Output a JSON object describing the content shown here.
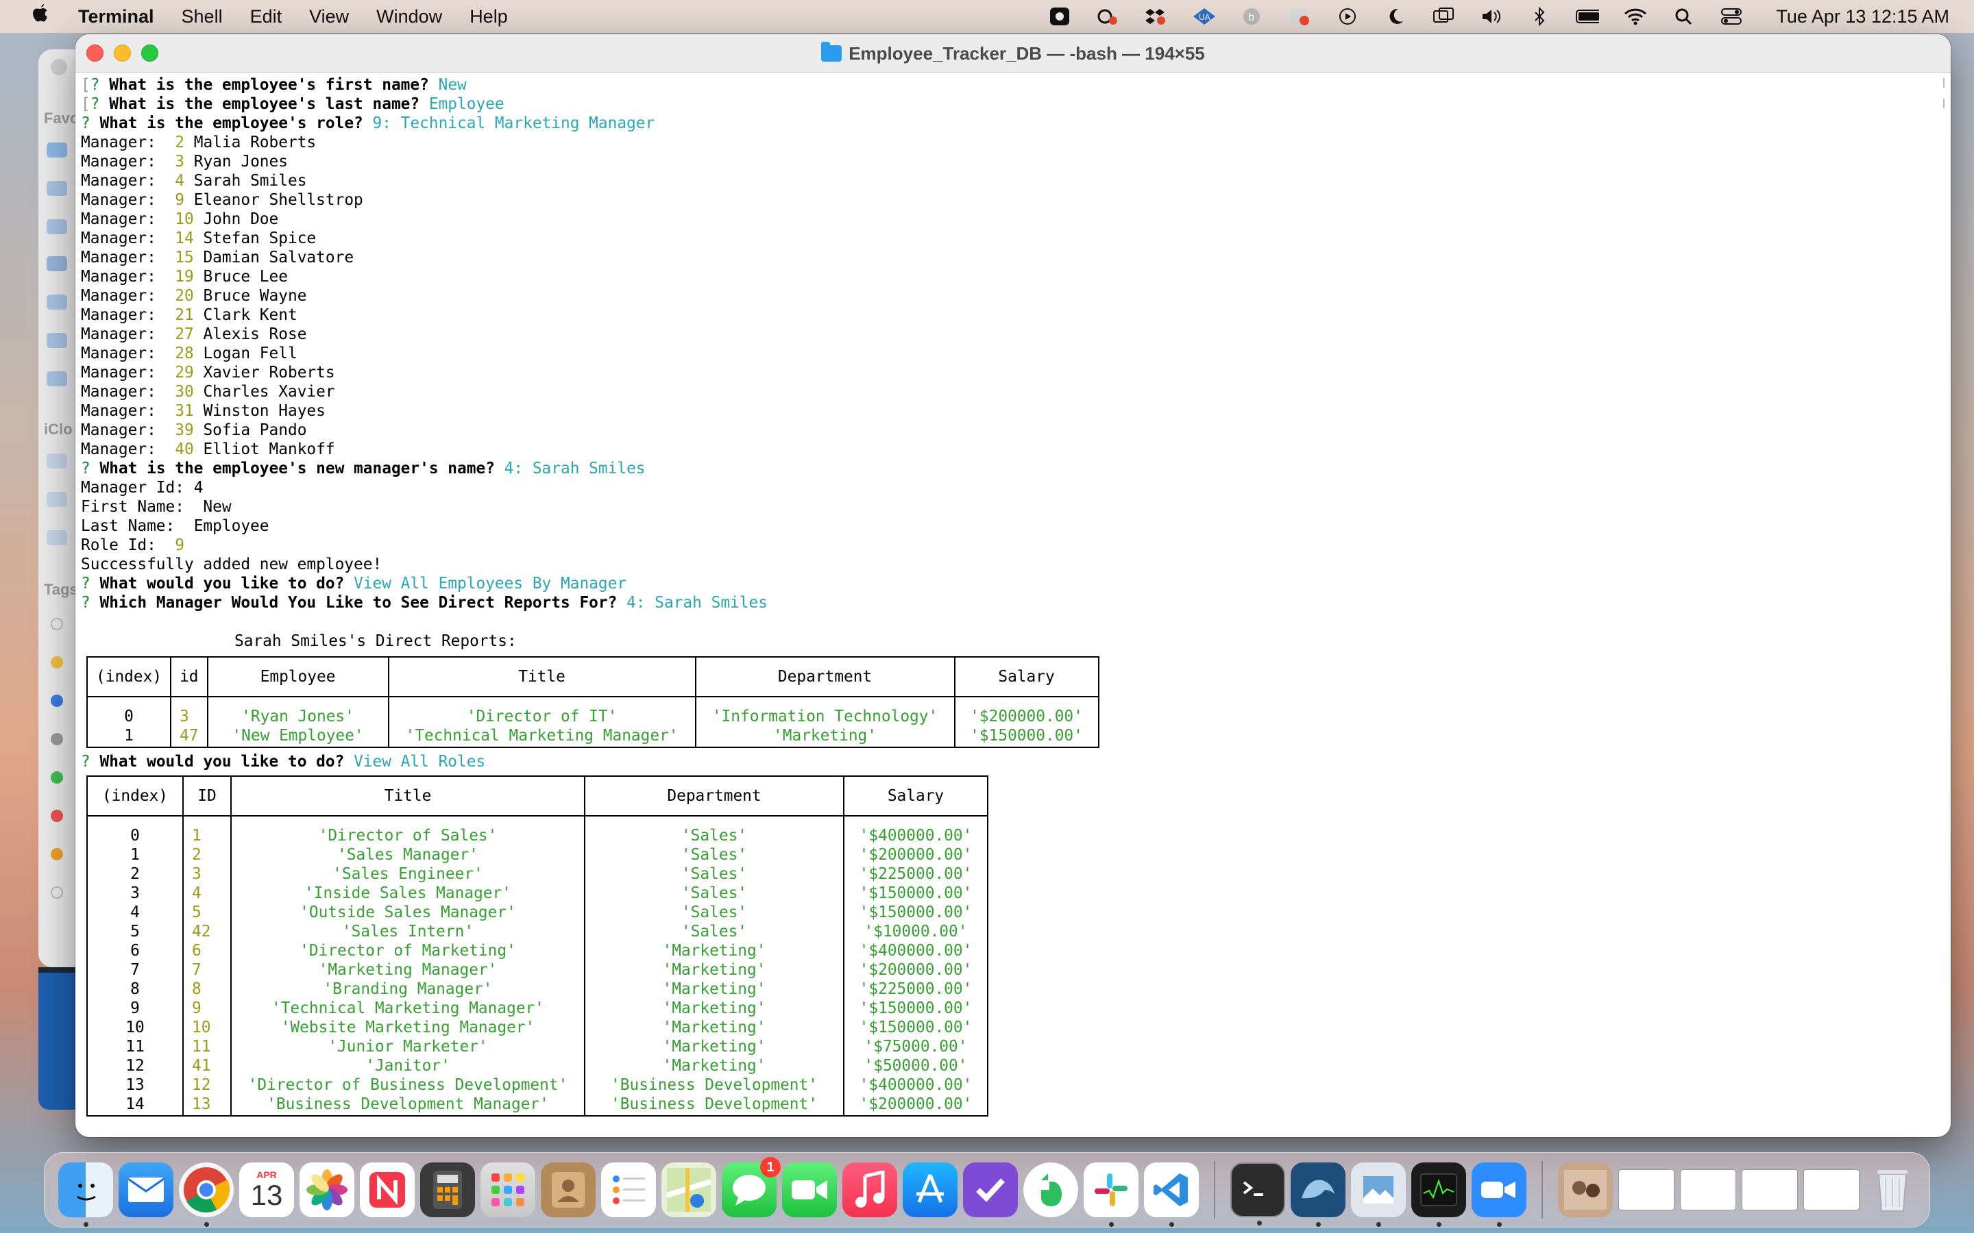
{
  "menubar": {
    "app_name": "Terminal",
    "menus": [
      "Shell",
      "Edit",
      "View",
      "Window",
      "Help"
    ],
    "clock": "Tue Apr 13  12:15 AM"
  },
  "window": {
    "title": "Employee_Tracker_DB — -bash — 194×55"
  },
  "terminal": {
    "prompt_first_name": {
      "q": "What is the employee's first name?",
      "a": "New"
    },
    "prompt_last_name": {
      "q": "What is the employee's last name?",
      "a": "Employee"
    },
    "prompt_role": {
      "q": "What is the employee's role?",
      "a": "9: Technical Marketing Manager"
    },
    "manager_label": "Manager:",
    "managers": [
      {
        "id": "2",
        "name": "Malia Roberts"
      },
      {
        "id": "3",
        "name": "Ryan Jones"
      },
      {
        "id": "4",
        "name": "Sarah Smiles"
      },
      {
        "id": "9",
        "name": "Eleanor Shellstrop"
      },
      {
        "id": "10",
        "name": "John Doe"
      },
      {
        "id": "14",
        "name": "Stefan Spice"
      },
      {
        "id": "15",
        "name": "Damian Salvatore"
      },
      {
        "id": "19",
        "name": "Bruce Lee"
      },
      {
        "id": "20",
        "name": "Bruce Wayne"
      },
      {
        "id": "21",
        "name": "Clark Kent"
      },
      {
        "id": "27",
        "name": "Alexis Rose"
      },
      {
        "id": "28",
        "name": "Logan Fell"
      },
      {
        "id": "29",
        "name": "Xavier Roberts"
      },
      {
        "id": "30",
        "name": "Charles Xavier"
      },
      {
        "id": "31",
        "name": "Winston Hayes"
      },
      {
        "id": "39",
        "name": "Sofia Pando"
      },
      {
        "id": "40",
        "name": "Elliot Mankoff"
      }
    ],
    "prompt_manager": {
      "q": "What is the employee's new manager's name?",
      "a": "4: Sarah Smiles"
    },
    "summary": {
      "manager_id": "Manager Id: 4",
      "first_name": "First Name:  New",
      "last_name": "Last Name:  Employee",
      "role_id_label": "Role Id:",
      "role_id": "9",
      "success": "Successfully added new employee!"
    },
    "prompt_todo_1": {
      "q": "What would you like to do?",
      "a": "View All Employees By Manager"
    },
    "prompt_which_manager": {
      "q": "Which Manager Would You Like to See Direct Reports For?",
      "a": "4: Sarah Smiles"
    },
    "direct_reports_heading": "Sarah Smiles's Direct Reports:",
    "direct_reports_table": {
      "headers": [
        "(index)",
        "id",
        "Employee",
        "Title",
        "Department",
        "Salary"
      ],
      "rows": [
        {
          "index": "0",
          "id": "3",
          "employee": "'Ryan Jones'",
          "title": "'Director of IT'",
          "department": "'Information Technology'",
          "salary": "'$200000.00'"
        },
        {
          "index": "1",
          "id": "47",
          "employee": "'New Employee'",
          "title": "'Technical Marketing Manager'",
          "department": "'Marketing'",
          "salary": "'$150000.00'"
        }
      ]
    },
    "prompt_todo_2": {
      "q": "What would you like to do?",
      "a": "View All Roles"
    },
    "roles_table": {
      "headers": [
        "(index)",
        "ID",
        "Title",
        "Department",
        "Salary"
      ],
      "rows": [
        {
          "index": "0",
          "id": "1",
          "title": "'Director of Sales'",
          "department": "'Sales'",
          "salary": "'$400000.00'"
        },
        {
          "index": "1",
          "id": "2",
          "title": "'Sales Manager'",
          "department": "'Sales'",
          "salary": "'$200000.00'"
        },
        {
          "index": "2",
          "id": "3",
          "title": "'Sales Engineer'",
          "department": "'Sales'",
          "salary": "'$225000.00'"
        },
        {
          "index": "3",
          "id": "4",
          "title": "'Inside Sales Manager'",
          "department": "'Sales'",
          "salary": "'$150000.00'"
        },
        {
          "index": "4",
          "id": "5",
          "title": "'Outside Sales Manager'",
          "department": "'Sales'",
          "salary": "'$150000.00'"
        },
        {
          "index": "5",
          "id": "42",
          "title": "'Sales Intern'",
          "department": "'Sales'",
          "salary": "'$10000.00'"
        },
        {
          "index": "6",
          "id": "6",
          "title": "'Director of Marketing'",
          "department": "'Marketing'",
          "salary": "'$400000.00'"
        },
        {
          "index": "7",
          "id": "7",
          "title": "'Marketing Manager'",
          "department": "'Marketing'",
          "salary": "'$200000.00'"
        },
        {
          "index": "8",
          "id": "8",
          "title": "'Branding Manager'",
          "department": "'Marketing'",
          "salary": "'$225000.00'"
        },
        {
          "index": "9",
          "id": "9",
          "title": "'Technical Marketing Manager'",
          "department": "'Marketing'",
          "salary": "'$150000.00'"
        },
        {
          "index": "10",
          "id": "10",
          "title": "'Website Marketing Manager'",
          "department": "'Marketing'",
          "salary": "'$150000.00'"
        },
        {
          "index": "11",
          "id": "11",
          "title": "'Junior Marketer'",
          "department": "'Marketing'",
          "salary": "'$75000.00'"
        },
        {
          "index": "12",
          "id": "41",
          "title": "'Janitor'",
          "department": "'Marketing'",
          "salary": "'$50000.00'"
        },
        {
          "index": "13",
          "id": "12",
          "title": "'Director of Business Development'",
          "department": "'Business Development'",
          "salary": "'$400000.00'"
        },
        {
          "index": "14",
          "id": "13",
          "title": "'Business Development Manager'",
          "department": "'Business Development'",
          "salary": "'$200000.00'"
        }
      ]
    }
  },
  "finder_sidebar": {
    "labels": [
      "Favo",
      "iClo",
      "Tags"
    ]
  },
  "dock": {
    "calendar_month": "APR",
    "calendar_day": "13",
    "messages_badge": "1",
    "apps": [
      "finder-icon",
      "mail-icon",
      "chrome-icon",
      "calendar-icon",
      "photos-icon",
      "news-icon",
      "calculator-icon",
      "launchpad-icon",
      "contacts-icon",
      "reminders-icon",
      "maps-icon",
      "messages-icon",
      "facetime-icon",
      "music-icon",
      "app-store-icon",
      "omnifocus-icon",
      "evernote-icon",
      "slack-icon",
      "vscode-icon",
      "terminal-icon",
      "mysql-workbench-icon",
      "preview-icon",
      "activity-monitor-icon",
      "zoom-icon"
    ]
  },
  "colors": {
    "prompt_green": "#1a8a2a",
    "answer_cyan": "#2aa7b5",
    "number_yellow": "#9c9a16",
    "value_green": "#38a033"
  }
}
